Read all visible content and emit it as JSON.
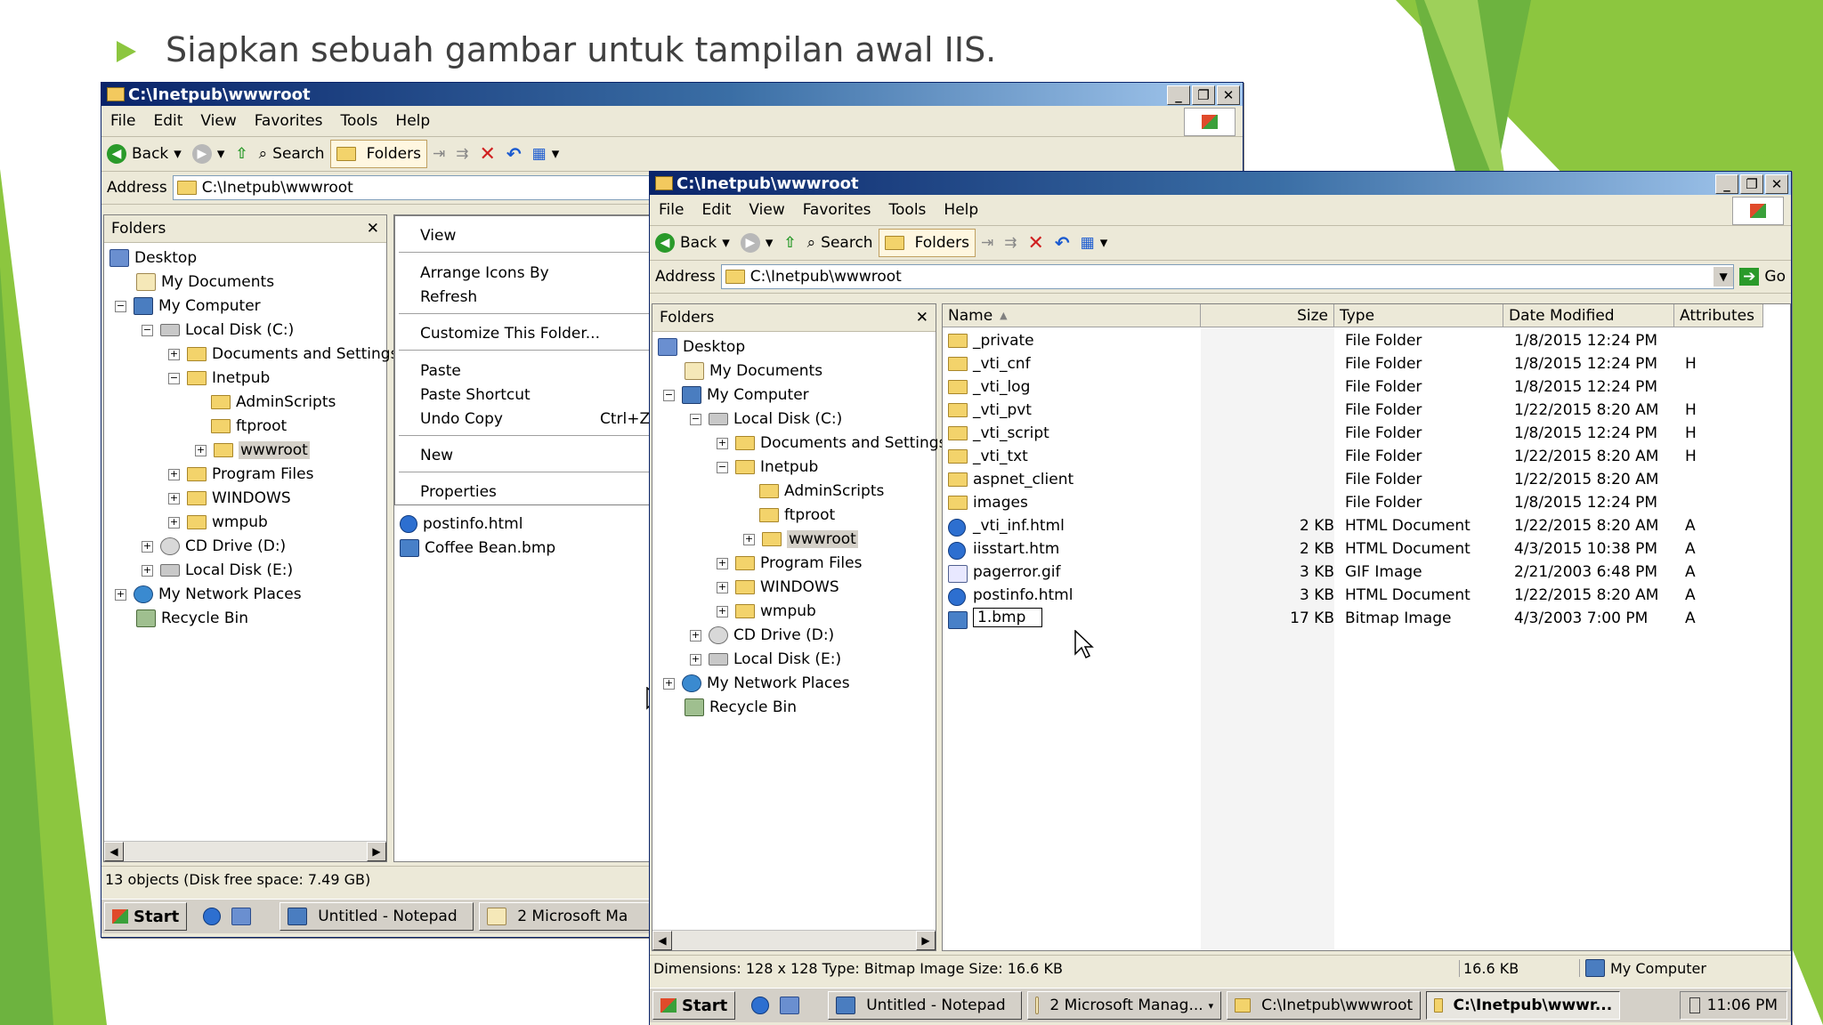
{
  "slide": {
    "bullet": "Siapkan sebuah gambar untuk tampilan awal IIS.",
    "accent_green": "#8cc63f",
    "dark_green": "#5e9e2e"
  },
  "window_back": {
    "title": "C:\\Inetpub\\wwwroot",
    "menu": [
      "File",
      "Edit",
      "View",
      "Favorites",
      "Tools",
      "Help"
    ],
    "toolbar": {
      "back": "Back",
      "search": "Search",
      "folders": "Folders"
    },
    "address_label": "Address",
    "address_value": "C:\\Inetpub\\wwwroot",
    "folders_label": "Folders",
    "tree": [
      "Desktop",
      "My Documents",
      "My Computer",
      "Local Disk (C:)",
      "Documents and Settings",
      "Inetpub",
      "AdminScripts",
      "ftproot",
      "wwwroot",
      "Program Files",
      "WINDOWS",
      "wmpub",
      "CD Drive (D:)",
      "Local Disk (E:)",
      "My Network Places",
      "Recycle Bin"
    ],
    "context_menu": [
      "View",
      "Arrange Icons By",
      "Refresh",
      "Customize This Folder...",
      "Paste",
      "Paste Shortcut",
      "Undo Copy",
      "New",
      "Properties"
    ],
    "undo_shortcut": "Ctrl+Z",
    "files": [
      "postinfo.html",
      "Coffee Bean.bmp"
    ],
    "status": "13 objects (Disk free space: 7.49 GB)",
    "taskbar": {
      "start": "Start",
      "notepad": "Untitled - Notepad",
      "mmc": "2 Microsoft Ma"
    }
  },
  "window_front": {
    "title": "C:\\Inetpub\\wwwroot",
    "menu": [
      "File",
      "Edit",
      "View",
      "Favorites",
      "Tools",
      "Help"
    ],
    "toolbar": {
      "back": "Back",
      "search": "Search",
      "folders": "Folders"
    },
    "address_label": "Address",
    "address_value": "C:\\Inetpub\\wwwroot",
    "go_label": "Go",
    "folders_label": "Folders",
    "tree": [
      "Desktop",
      "My Documents",
      "My Computer",
      "Local Disk (C:)",
      "Documents and Settings",
      "Inetpub",
      "AdminScripts",
      "ftproot",
      "wwwroot",
      "Program Files",
      "WINDOWS",
      "wmpub",
      "CD Drive (D:)",
      "Local Disk (E:)",
      "My Network Places",
      "Recycle Bin"
    ],
    "columns": [
      "Name",
      "Size",
      "Type",
      "Date Modified",
      "Attributes"
    ],
    "files": [
      {
        "name": "_private",
        "size": "",
        "type": "File Folder",
        "date": "1/8/2015 12:24 PM",
        "attr": "",
        "icon": "folder-icon"
      },
      {
        "name": "_vti_cnf",
        "size": "",
        "type": "File Folder",
        "date": "1/8/2015 12:24 PM",
        "attr": "H",
        "icon": "folder-icon"
      },
      {
        "name": "_vti_log",
        "size": "",
        "type": "File Folder",
        "date": "1/8/2015 12:24 PM",
        "attr": "",
        "icon": "folder-icon"
      },
      {
        "name": "_vti_pvt",
        "size": "",
        "type": "File Folder",
        "date": "1/22/2015 8:20 AM",
        "attr": "H",
        "icon": "folder-icon"
      },
      {
        "name": "_vti_script",
        "size": "",
        "type": "File Folder",
        "date": "1/8/2015 12:24 PM",
        "attr": "H",
        "icon": "folder-icon"
      },
      {
        "name": "_vti_txt",
        "size": "",
        "type": "File Folder",
        "date": "1/22/2015 8:20 AM",
        "attr": "H",
        "icon": "folder-icon"
      },
      {
        "name": "aspnet_client",
        "size": "",
        "type": "File Folder",
        "date": "1/22/2015 8:20 AM",
        "attr": "",
        "icon": "folder-icon"
      },
      {
        "name": "images",
        "size": "",
        "type": "File Folder",
        "date": "1/8/2015 12:24 PM",
        "attr": "",
        "icon": "folder-icon"
      },
      {
        "name": "_vti_inf.html",
        "size": "2 KB",
        "type": "HTML Document",
        "date": "1/22/2015 8:20 AM",
        "attr": "A",
        "icon": "html-icon"
      },
      {
        "name": "iisstart.htm",
        "size": "2 KB",
        "type": "HTML Document",
        "date": "4/3/2015 10:38 PM",
        "attr": "A",
        "icon": "html-icon"
      },
      {
        "name": "pagerror.gif",
        "size": "3 KB",
        "type": "GIF Image",
        "date": "2/21/2003 6:48 PM",
        "attr": "A",
        "icon": "gif-icon"
      },
      {
        "name": "postinfo.html",
        "size": "3 KB",
        "type": "HTML Document",
        "date": "1/22/2015 8:20 AM",
        "attr": "A",
        "icon": "html-icon"
      },
      {
        "name": "1.bmp",
        "size": "17 KB",
        "type": "Bitmap Image",
        "date": "4/3/2003 7:00 PM",
        "attr": "A",
        "icon": "bmp-icon"
      }
    ],
    "rename_value": "1.bmp",
    "status": {
      "details": "Dimensions: 128 x 128 Type: Bitmap Image Size: 16.6 KB",
      "size": "16.6 KB",
      "location": "My Computer"
    },
    "taskbar": {
      "start": "Start",
      "notepad": "Untitled - Notepad",
      "mmc": "2 Microsoft Manag...",
      "explorer1": "C:\\Inetpub\\wwwroot",
      "explorer2": "C:\\Inetpub\\wwwr...",
      "clock": "11:06 PM"
    }
  }
}
